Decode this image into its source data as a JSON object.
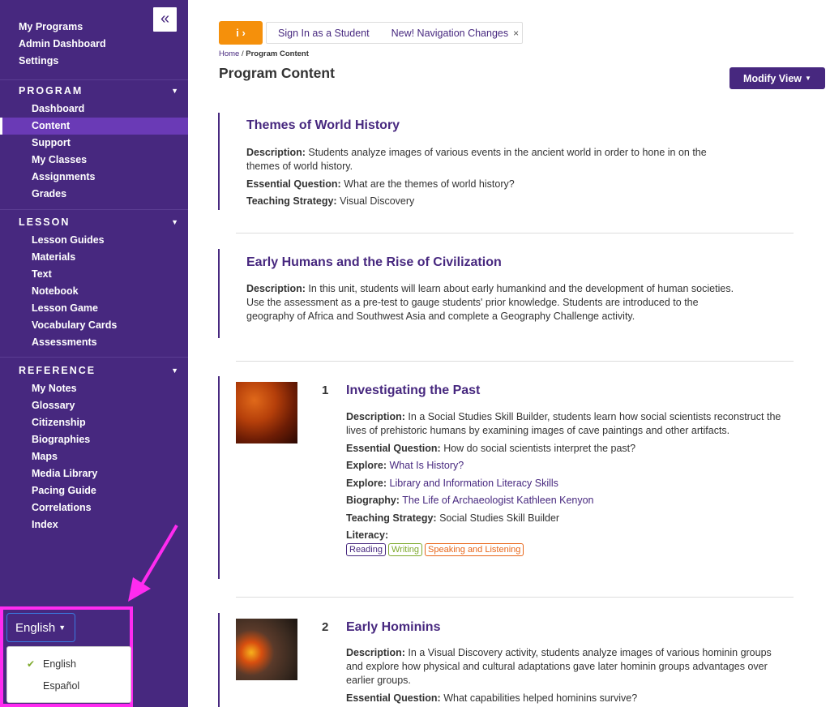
{
  "sidebar": {
    "collapse_icon": "«",
    "top_links": [
      "My Programs",
      "Admin Dashboard",
      "Settings"
    ],
    "sections": [
      {
        "title": "PROGRAM",
        "items": [
          "Dashboard",
          "Content",
          "Support",
          "My Classes",
          "Assignments",
          "Grades"
        ],
        "active": "Content"
      },
      {
        "title": "LESSON",
        "items": [
          "Lesson Guides",
          "Materials",
          "Text",
          "Notebook",
          "Lesson Game",
          "Vocabulary Cards",
          "Assessments"
        ]
      },
      {
        "title": "REFERENCE",
        "items": [
          "My Notes",
          "Glossary",
          "Citizenship",
          "Biographies",
          "Maps",
          "Media Library",
          "Pacing Guide",
          "Correlations",
          "Index"
        ]
      }
    ],
    "caret": "▼",
    "language": {
      "selected": "English",
      "options": [
        "English",
        "Español"
      ],
      "check": "✔"
    }
  },
  "notice": {
    "icon": "i ›",
    "links": [
      "Sign In as a Student",
      "New! Navigation Changes"
    ],
    "close": "×"
  },
  "breadcrumb": {
    "home": "Home",
    "separator": "/",
    "current": "Program Content"
  },
  "page_title": "Program Content",
  "modify_view": "Modify View",
  "cards": [
    {
      "title": "Themes of World History",
      "fields": [
        {
          "label": "Description:",
          "text": "Students analyze images of various events in the ancient world in order to hone in on the themes of world history."
        },
        {
          "label": "Essential Question:",
          "text": "What are the themes of world history?"
        },
        {
          "label": "Teaching Strategy:",
          "text": "Visual Discovery"
        }
      ]
    },
    {
      "title": "Early Humans and the Rise of Civilization",
      "fields": [
        {
          "label": "Description:",
          "text": "In this unit, students will learn about early humankind and the development of human societies. Use the assessment as a pre-test to gauge students' prior knowledge. Students are introduced to the geography of Africa and Southwest Asia and complete a Geography Challenge activity."
        }
      ]
    }
  ],
  "lessons": [
    {
      "number": "1",
      "title": "Investigating the Past",
      "description_label": "Description:",
      "description": "In a Social Studies Skill Builder, students learn how social scientists reconstruct the lives of prehistoric humans by examining images of cave paintings and other artifacts.",
      "eq_label": "Essential Question:",
      "eq": "How do social scientists interpret the past?",
      "links": [
        {
          "label": "Explore:",
          "text": "What Is History?"
        },
        {
          "label": "Explore:",
          "text": "Library and Information Literacy Skills"
        },
        {
          "label": "Biography:",
          "text": "The Life of Archaeologist Kathleen Kenyon"
        }
      ],
      "strategy_label": "Teaching Strategy:",
      "strategy": "Social Studies Skill Builder",
      "literacy_label": "Literacy:",
      "tags": [
        {
          "text": "Reading",
          "color": "#47287f"
        },
        {
          "text": "Writing",
          "color": "#7eaa2d"
        },
        {
          "text": "Speaking and Listening",
          "color": "#e8671b"
        }
      ]
    },
    {
      "number": "2",
      "title": "Early Hominins",
      "description_label": "Description:",
      "description": "In a Visual Discovery activity, students analyze images of various hominin groups and explore how physical and cultural adaptations gave later hominin groups advantages over earlier groups.",
      "eq_label": "Essential Question:",
      "eq": "What capabilities helped hominins survive?"
    }
  ],
  "colors": {
    "brand": "#47287f",
    "active_nav": "#6a3ab6",
    "notice": "#f5900b",
    "highlight": "#ff2bf0"
  }
}
